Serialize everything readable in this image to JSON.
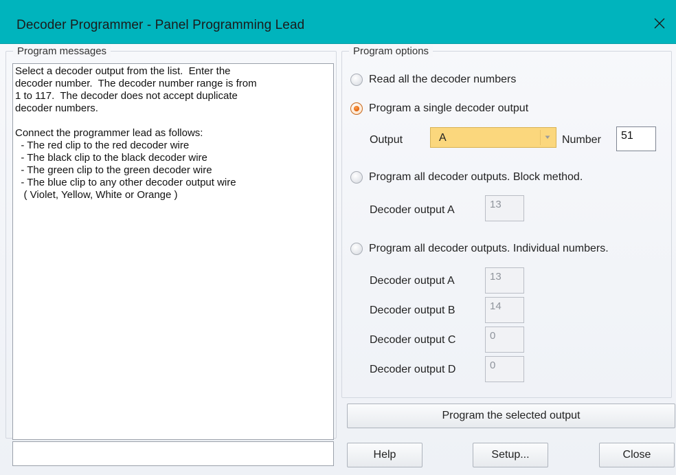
{
  "window": {
    "title": "Decoder Programmer  -  Panel Programming Lead"
  },
  "messages_group": {
    "legend": "Program messages",
    "paragraph1": "Select a decoder output from the list.  Enter the\ndecoder number.  The decoder number range is from\n1 to 117.  The decoder does not accept duplicate\ndecoder numbers.",
    "paragraph2": "Connect the programmer lead as follows:\n  - The red clip to the red decoder wire\n  - The black clip to the black decoder wire\n  - The green clip to the green decoder wire\n  - The blue clip to any other decoder output wire\n   ( Violet, Yellow, White or Orange )",
    "status_text": ""
  },
  "options_group": {
    "legend": "Program options",
    "radio_read_all": "Read all the decoder numbers",
    "radio_single": "Program a single decoder output",
    "output_label": "Output",
    "output_selected": "A",
    "number_label": "Number",
    "number_value": "51",
    "radio_block": "Program all decoder outputs.  Block method.",
    "block_output_label": "Decoder output  A",
    "block_output_value": "13",
    "radio_individual": "Program all decoder outputs.  Individual numbers.",
    "individual": [
      {
        "label": "Decoder output A",
        "value": "13"
      },
      {
        "label": "Decoder output B",
        "value": "14"
      },
      {
        "label": "Decoder output C",
        "value": "0"
      },
      {
        "label": "Decoder output D",
        "value": "0"
      }
    ],
    "selected_radio": "single"
  },
  "buttons": {
    "program": "Program the selected output",
    "help": "Help",
    "setup": "Setup...",
    "close": "Close"
  },
  "colors": {
    "title_bar": "#00b4bd",
    "combo_highlight": "#fbd77d",
    "radio_selected": "#e0620c"
  },
  "icons": {
    "window_close": "close-icon",
    "combo_arrow": "chevron-down-icon"
  }
}
